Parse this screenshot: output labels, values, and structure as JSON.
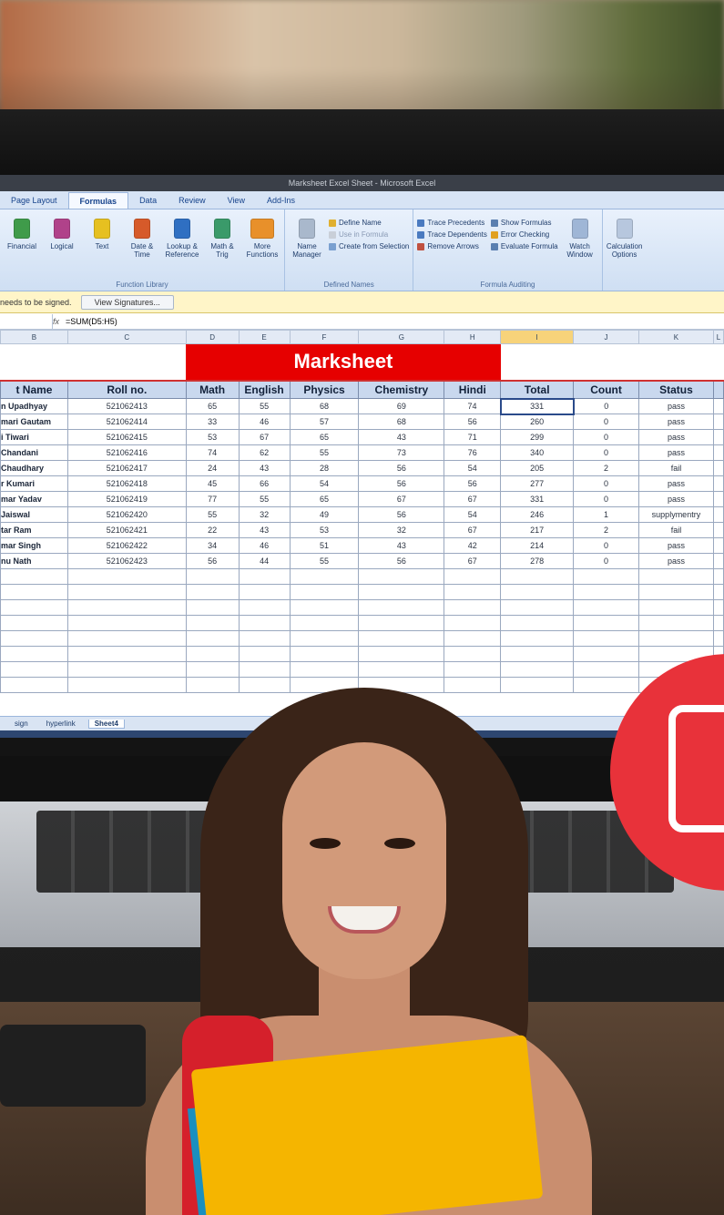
{
  "window_title": "Marksheet Excel Sheet - Microsoft Excel",
  "ribbon": {
    "tabs": [
      "Page Layout",
      "Formulas",
      "Data",
      "Review",
      "View",
      "Add-Ins"
    ],
    "active_tab": "Formulas",
    "function_library": {
      "label": "Function Library",
      "buttons": [
        "Financial",
        "Logical",
        "Text",
        "Date & Time",
        "Lookup & Reference",
        "Math & Trig",
        "More Functions"
      ]
    },
    "defined_names": {
      "label": "Defined Names",
      "name_manager": "Name Manager",
      "items": [
        "Define Name",
        "Use in Formula",
        "Create from Selection"
      ]
    },
    "formula_auditing": {
      "label": "Formula Auditing",
      "items": [
        "Trace Precedents",
        "Trace Dependents",
        "Remove Arrows",
        "Show Formulas",
        "Error Checking",
        "Evaluate Formula"
      ],
      "watch_window": "Watch Window"
    },
    "calculation": "Calculation Options"
  },
  "message_bar": {
    "text": "needs to be signed.",
    "button": "View Signatures..."
  },
  "formula_bar": {
    "fx": "fx",
    "formula": "=SUM(D5:H5)"
  },
  "column_headers": [
    "B",
    "C",
    "D",
    "E",
    "F",
    "G",
    "H",
    "I",
    "J",
    "K",
    "L"
  ],
  "selected_column": "I",
  "sheet": {
    "title": "Marksheet",
    "headers": [
      "t Name",
      "Roll no.",
      "Math",
      "English",
      "Physics",
      "Chemistry",
      "Hindi",
      "Total",
      "Count",
      "Status",
      ""
    ],
    "rows": [
      [
        "n Upadhyay",
        "521062413",
        "65",
        "55",
        "68",
        "69",
        "74",
        "331",
        "0",
        "pass"
      ],
      [
        "mari Gautam",
        "521062414",
        "33",
        "46",
        "57",
        "68",
        "56",
        "260",
        "0",
        "pass"
      ],
      [
        "i Tiwari",
        "521062415",
        "53",
        "67",
        "65",
        "43",
        "71",
        "299",
        "0",
        "pass"
      ],
      [
        "Chandani",
        "521062416",
        "74",
        "62",
        "55",
        "73",
        "76",
        "340",
        "0",
        "pass"
      ],
      [
        "Chaudhary",
        "521062417",
        "24",
        "43",
        "28",
        "56",
        "54",
        "205",
        "2",
        "fail"
      ],
      [
        "r Kumari",
        "521062418",
        "45",
        "66",
        "54",
        "56",
        "56",
        "277",
        "0",
        "pass"
      ],
      [
        "mar Yadav",
        "521062419",
        "77",
        "55",
        "65",
        "67",
        "67",
        "331",
        "0",
        "pass"
      ],
      [
        "Jaiswal",
        "521062420",
        "55",
        "32",
        "49",
        "56",
        "54",
        "246",
        "1",
        "supplymentry"
      ],
      [
        "tar Ram",
        "521062421",
        "22",
        "43",
        "53",
        "32",
        "67",
        "217",
        "2",
        "fail"
      ],
      [
        "mar Singh",
        "521062422",
        "34",
        "46",
        "51",
        "43",
        "42",
        "214",
        "0",
        "pass"
      ],
      [
        "nu Nath",
        "521062423",
        "56",
        "44",
        "55",
        "56",
        "67",
        "278",
        "0",
        "pass"
      ]
    ],
    "empty_rows": 8
  },
  "sheet_tabs": [
    "sign",
    "hyperlink",
    "Sheet4"
  ],
  "active_sheet_tab": "Sheet4",
  "colors": {
    "title_red": "#e60000",
    "header_blue": "#c9d8ee",
    "badge_red": "#e8323a",
    "folder_yellow": "#f5b500"
  }
}
